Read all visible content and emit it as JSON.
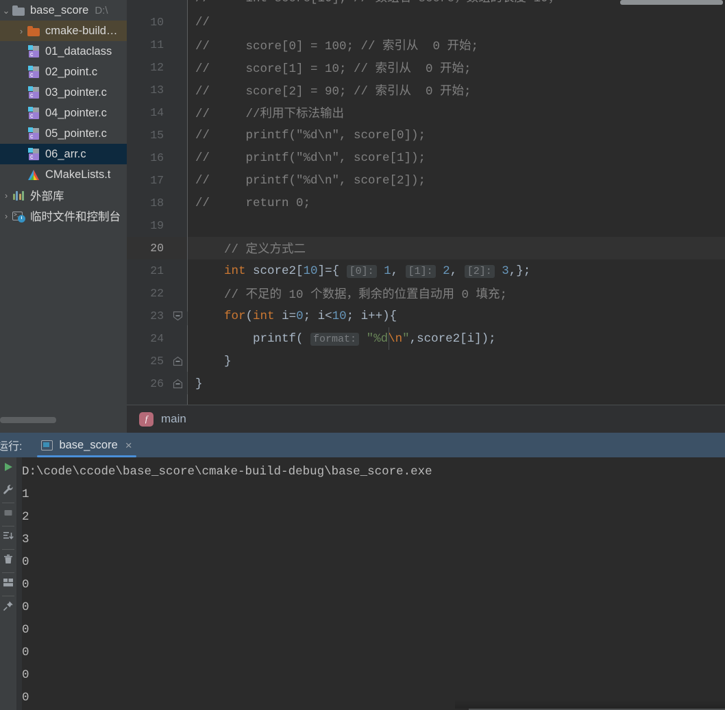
{
  "app": {
    "theme_bg": "#2b2b2b",
    "panel_bg": "#3c3f41",
    "accent": "#4a90d9"
  },
  "project_tree": {
    "items": [
      {
        "twisty": "⌄",
        "icon": "folder-icon",
        "label": "base_score",
        "path": "D:\\",
        "state": "expanded",
        "row_style": "none"
      },
      {
        "twisty": "›",
        "icon": "folder-orange-icon",
        "label": "cmake-build…",
        "path": "",
        "state": "collapsed",
        "row_style": "build"
      },
      {
        "twisty": "",
        "icon": "c-file-icon",
        "label": "01_dataclass",
        "path": "",
        "state": "",
        "row_style": "none"
      },
      {
        "twisty": "",
        "icon": "c-file-icon",
        "label": "02_point.c",
        "path": "",
        "state": "",
        "row_style": "none"
      },
      {
        "twisty": "",
        "icon": "c-file-icon",
        "label": "03_pointer.c",
        "path": "",
        "state": "",
        "row_style": "none"
      },
      {
        "twisty": "",
        "icon": "c-file-icon",
        "label": "04_pointer.c",
        "path": "",
        "state": "",
        "row_style": "none"
      },
      {
        "twisty": "",
        "icon": "c-file-icon",
        "label": "05_pointer.c",
        "path": "",
        "state": "",
        "row_style": "none"
      },
      {
        "twisty": "",
        "icon": "c-file-icon",
        "label": "06_arr.c",
        "path": "",
        "state": "selected",
        "row_style": "file"
      },
      {
        "twisty": "",
        "icon": "cmake-icon",
        "label": "CMakeLists.t",
        "path": "",
        "state": "",
        "row_style": "none"
      },
      {
        "twisty": "›",
        "icon": "library-icon",
        "label": "外部库",
        "path": "",
        "state": "collapsed",
        "row_style": "none"
      },
      {
        "twisty": "›",
        "icon": "terminal-clock-icon",
        "label": "临时文件和控制台",
        "path": "",
        "state": "collapsed",
        "row_style": "none"
      }
    ]
  },
  "editor": {
    "lines": [
      {
        "num": "10",
        "highlight": false,
        "fold": "",
        "tokens": [
          {
            "t": "//",
            "c": "cmt"
          }
        ]
      },
      {
        "num": "11",
        "highlight": false,
        "fold": "",
        "tokens": [
          {
            "t": "//     score[0] = 100; // 索引从  0 开始;",
            "c": "cmt"
          }
        ]
      },
      {
        "num": "12",
        "highlight": false,
        "fold": "",
        "tokens": [
          {
            "t": "//     score[1] = 10; // 索引从  0 开始;",
            "c": "cmt"
          }
        ]
      },
      {
        "num": "13",
        "highlight": false,
        "fold": "",
        "tokens": [
          {
            "t": "//     score[2] = 90; // 索引从  0 开始;",
            "c": "cmt"
          }
        ]
      },
      {
        "num": "14",
        "highlight": false,
        "fold": "",
        "tokens": [
          {
            "t": "//     //利用下标法输出",
            "c": "cmt"
          }
        ]
      },
      {
        "num": "15",
        "highlight": false,
        "fold": "",
        "tokens": [
          {
            "t": "//     printf(\"%d\\n\", score[0]);",
            "c": "cmt"
          }
        ]
      },
      {
        "num": "16",
        "highlight": false,
        "fold": "",
        "tokens": [
          {
            "t": "//     printf(\"%d\\n\", score[1]);",
            "c": "cmt"
          }
        ]
      },
      {
        "num": "17",
        "highlight": false,
        "fold": "",
        "tokens": [
          {
            "t": "//     printf(\"%d\\n\", score[2]);",
            "c": "cmt"
          }
        ]
      },
      {
        "num": "18",
        "highlight": false,
        "fold": "",
        "tokens": [
          {
            "t": "//     return 0;",
            "c": "cmt"
          }
        ]
      },
      {
        "num": "19",
        "highlight": false,
        "fold": "",
        "tokens": []
      },
      {
        "num": "20",
        "highlight": true,
        "fold": "",
        "tokens": [
          {
            "t": "    // 定义方式二",
            "c": "cmt"
          }
        ]
      },
      {
        "num": "21",
        "highlight": false,
        "fold": "",
        "tokens": [
          {
            "t": "    ",
            "c": "plain"
          },
          {
            "t": "int",
            "c": "kw"
          },
          {
            "t": " score2[",
            "c": "plain"
          },
          {
            "t": "10",
            "c": "num"
          },
          {
            "t": "]={ ",
            "c": "plain"
          },
          {
            "t": "[0]:",
            "c": "hint"
          },
          {
            "t": " ",
            "c": "plain"
          },
          {
            "t": "1",
            "c": "num"
          },
          {
            "t": ", ",
            "c": "plain"
          },
          {
            "t": "[1]:",
            "c": "hint"
          },
          {
            "t": " ",
            "c": "plain"
          },
          {
            "t": "2",
            "c": "num"
          },
          {
            "t": ", ",
            "c": "plain"
          },
          {
            "t": "[2]:",
            "c": "hint"
          },
          {
            "t": " ",
            "c": "plain"
          },
          {
            "t": "3",
            "c": "num"
          },
          {
            "t": ",};",
            "c": "plain"
          }
        ]
      },
      {
        "num": "22",
        "highlight": false,
        "fold": "",
        "tokens": [
          {
            "t": "    // 不足的 10 个数据，剩余的位置自动用 0 填充;",
            "c": "cmt"
          }
        ]
      },
      {
        "num": "23",
        "highlight": false,
        "fold": "minus-open",
        "tokens": [
          {
            "t": "    ",
            "c": "plain"
          },
          {
            "t": "for",
            "c": "kw"
          },
          {
            "t": "(",
            "c": "plain"
          },
          {
            "t": "int",
            "c": "kw"
          },
          {
            "t": " i=",
            "c": "plain"
          },
          {
            "t": "0",
            "c": "num"
          },
          {
            "t": "; i<",
            "c": "plain"
          },
          {
            "t": "10",
            "c": "num"
          },
          {
            "t": "; i++){",
            "c": "plain"
          }
        ]
      },
      {
        "num": "24",
        "highlight": false,
        "fold": "bar",
        "tokens": [
          {
            "t": "        printf( ",
            "c": "plain"
          },
          {
            "t": "format:",
            "c": "hint"
          },
          {
            "t": " ",
            "c": "plain"
          },
          {
            "t": "\"%d",
            "c": "str"
          },
          {
            "t": "\\n",
            "c": "esc"
          },
          {
            "t": "\"",
            "c": "str"
          },
          {
            "t": ",score2[i]);",
            "c": "plain"
          }
        ]
      },
      {
        "num": "25",
        "highlight": false,
        "fold": "minus-end",
        "tokens": [
          {
            "t": "    }",
            "c": "plain"
          }
        ]
      },
      {
        "num": "26",
        "highlight": false,
        "fold": "minus-end2",
        "tokens": [
          {
            "t": "}",
            "c": "plain"
          }
        ]
      }
    ]
  },
  "breadcrumb": {
    "icon": "function-icon",
    "icon_glyph": "f",
    "label": "main"
  },
  "run_panel": {
    "title": "运行:",
    "tab_label": "base_score",
    "tab_close": "×",
    "toolbar": [
      {
        "name": "rerun-button",
        "icon": "play-icon"
      },
      {
        "name": "edit-configurations-button",
        "icon": "wrench-icon"
      },
      {
        "name": "stop-button",
        "icon": "stop-square-icon"
      },
      {
        "name": "scroll-to-end-button",
        "icon": "scroll-down-icon"
      },
      {
        "name": "clear-all-button",
        "icon": "trash-icon"
      },
      {
        "name": "layout-settings-button",
        "icon": "layout-icon"
      },
      {
        "name": "pin-tab-button",
        "icon": "pin-icon"
      }
    ],
    "console_lines": [
      "D:\\code\\ccode\\base_score\\cmake-build-debug\\base_score.exe",
      "1",
      "2",
      "3",
      "0",
      "0",
      "0",
      "0",
      "0",
      "0",
      "0"
    ]
  }
}
